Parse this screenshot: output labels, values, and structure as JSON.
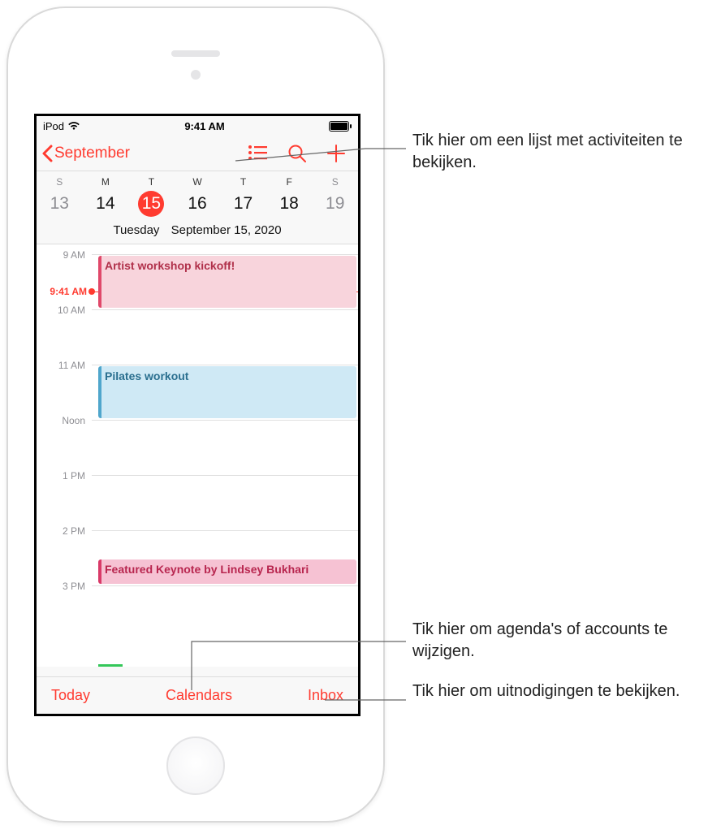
{
  "statusbar": {
    "device": "iPod",
    "time": "9:41 AM"
  },
  "navbar": {
    "back_label": "September"
  },
  "week": {
    "letters": [
      "S",
      "M",
      "T",
      "W",
      "T",
      "F",
      "S"
    ],
    "numbers": [
      13,
      14,
      15,
      16,
      17,
      18,
      19
    ],
    "selected_index": 2,
    "subdate_day": "Tuesday",
    "subdate_full": "September 15, 2020"
  },
  "timeline": {
    "hours": [
      "9 AM",
      "10 AM",
      "11 AM",
      "Noon",
      "1 PM",
      "2 PM",
      "3 PM"
    ],
    "now_label": "9:41 AM",
    "events": [
      {
        "title": "Artist workshop kickoff!",
        "color": "pink"
      },
      {
        "title": "Pilates workout",
        "color": "blue"
      },
      {
        "title": "Featured Keynote by Lindsey Bukhari",
        "color": "red"
      }
    ]
  },
  "toolbar": {
    "today": "Today",
    "calendars": "Calendars",
    "inbox": "Inbox"
  },
  "callouts": {
    "list": "Tik hier om een lijst met activiteiten te bekijken.",
    "calendars": "Tik hier om agenda's of accounts te wijzigen.",
    "inbox": "Tik hier om uitnodigingen te bekijken."
  }
}
